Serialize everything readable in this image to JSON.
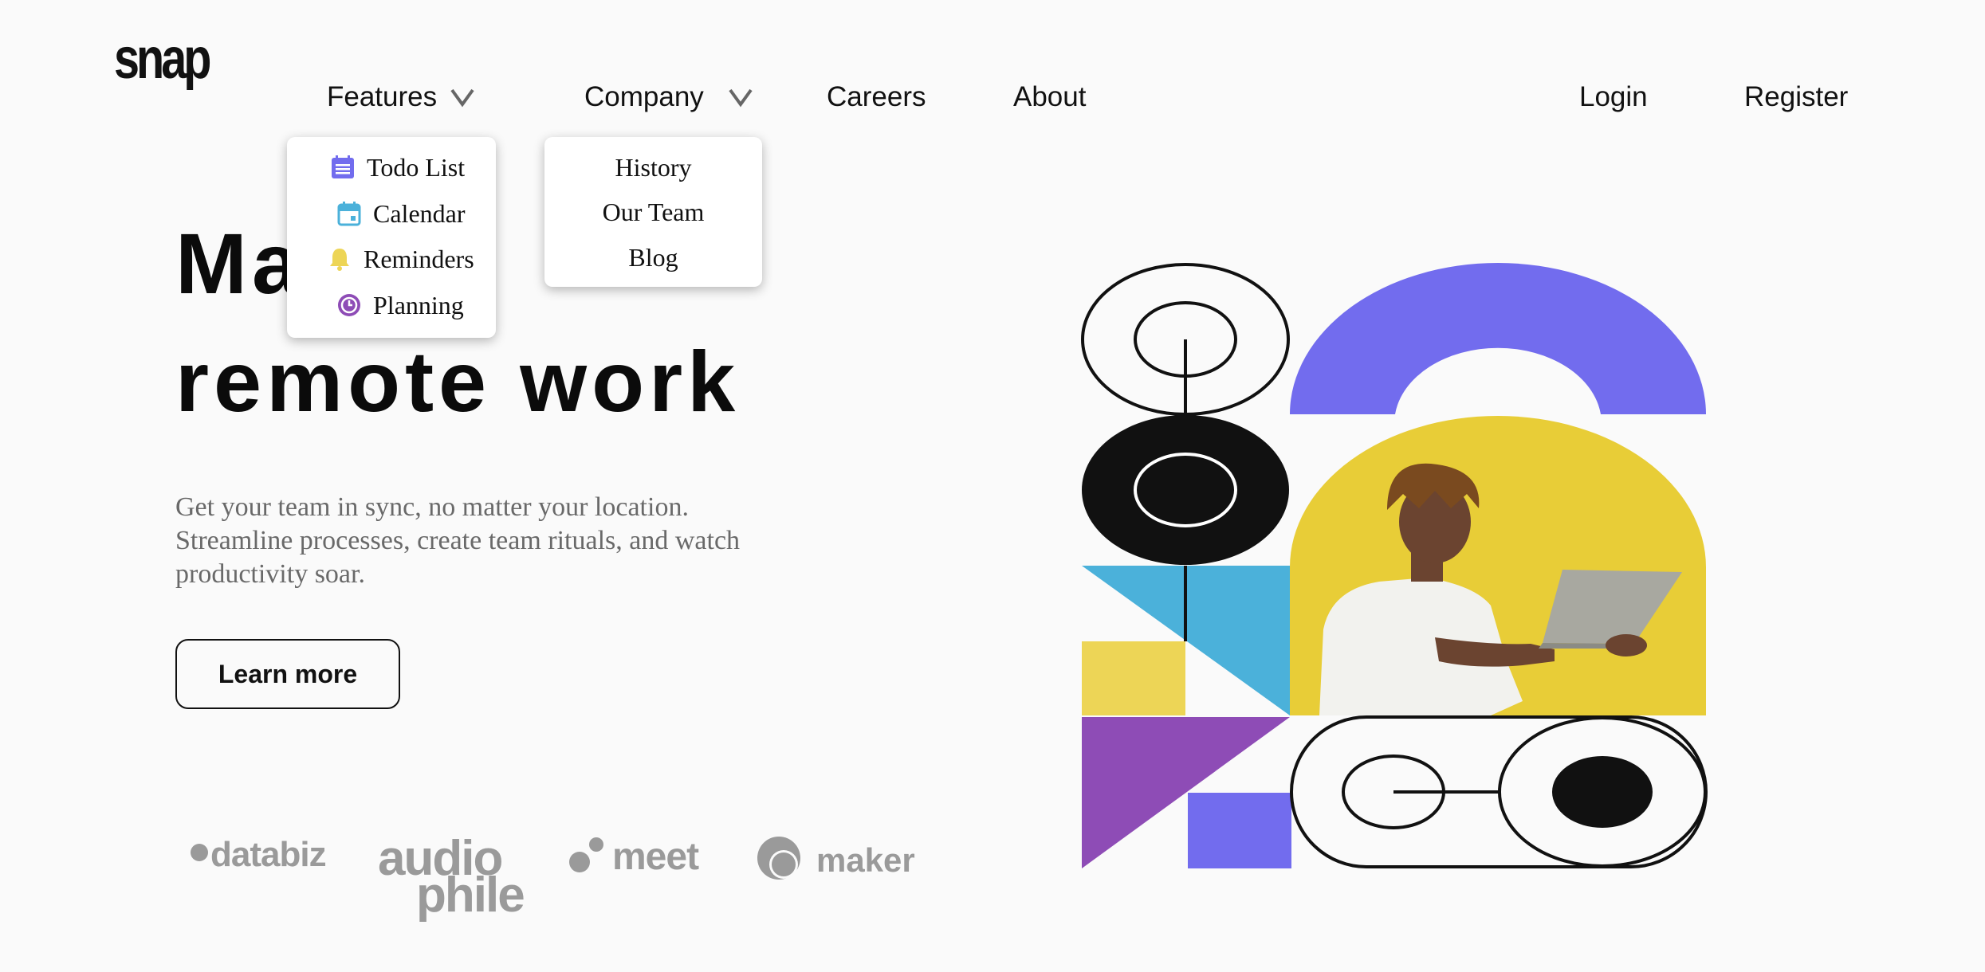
{
  "header": {
    "logo": "snap",
    "nav": {
      "features": "Features",
      "company": "Company",
      "careers": "Careers",
      "about": "About"
    },
    "auth": {
      "login": "Login",
      "register": "Register"
    }
  },
  "features_menu": {
    "items": [
      {
        "label": "Todo List",
        "icon": "todo-icon",
        "color": "#726cee"
      },
      {
        "label": "Calendar",
        "icon": "calendar-icon",
        "color": "#4bb1da"
      },
      {
        "label": "Reminders",
        "icon": "bell-icon",
        "color": "#edd556"
      },
      {
        "label": "Planning",
        "icon": "clock-icon",
        "color": "#8e4cb6"
      }
    ]
  },
  "company_menu": {
    "items": [
      {
        "label": "History"
      },
      {
        "label": "Our Team"
      },
      {
        "label": "Blog"
      }
    ]
  },
  "hero": {
    "title_line1": "Make",
    "title_line2": "remote work",
    "description": "Get your team in sync, no matter your location. Streamline processes, create team rituals, and watch productivity soar.",
    "cta": "Learn more"
  },
  "clients": {
    "databiz": "databiz",
    "audiophile_top": "audio",
    "audiophile_bottom": "phile",
    "meet": "meet",
    "maker": "maker"
  },
  "colors": {
    "purple": "#726cee",
    "blue": "#4bb1da",
    "yellow": "#edd556",
    "violet": "#8e4cb6",
    "dark": "#111111"
  }
}
